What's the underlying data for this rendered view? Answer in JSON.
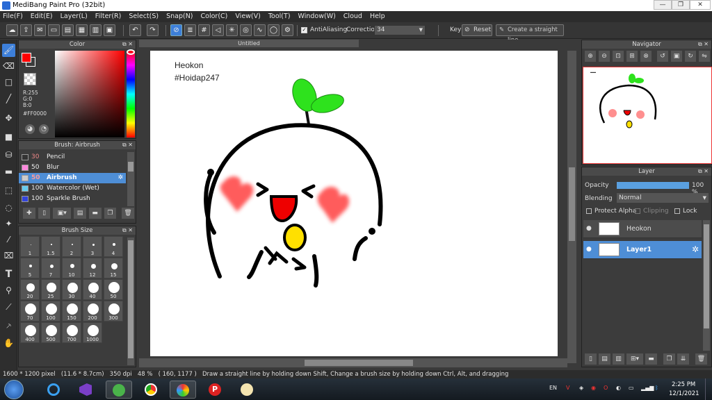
{
  "window": {
    "title": "MediBang Paint Pro (32bit)"
  },
  "menu": [
    "File(F)",
    "Edit(E)",
    "Layer(L)",
    "Filter(R)",
    "Select(S)",
    "Snap(N)",
    "Color(C)",
    "View(V)",
    "Tool(T)",
    "Window(W)",
    "Cloud",
    "Help"
  ],
  "toolbar": {
    "antialias_label": "AntiAliasing",
    "correction_label": "Correction",
    "correction_value": "34",
    "key_label": "Key",
    "reset_label": "Reset",
    "straight_line_label": "Create a straight line"
  },
  "color_panel": {
    "title": "Color",
    "r": "R:255",
    "g": "G:0",
    "b": "B:0",
    "hex": "#FF0000",
    "primary_color": "#ff0000",
    "secondary_color": "#000000"
  },
  "brush_panel": {
    "title": "Brush: Airbrush",
    "items": [
      {
        "size": "30",
        "name": "Pencil",
        "color": "#333333"
      },
      {
        "size": "50",
        "name": "Blur",
        "color": "#ff88dd"
      },
      {
        "size": "50",
        "name": "Airbrush",
        "color": "#cccccc"
      },
      {
        "size": "100",
        "name": "Watercolor (Wet)",
        "color": "#66ccee"
      },
      {
        "size": "100",
        "name": "Sparkle Brush",
        "color": "#3344dd"
      }
    ]
  },
  "brush_size_panel": {
    "title": "Brush Size",
    "sizes": [
      "1",
      "1.5",
      "2",
      "3",
      "4",
      "5",
      "7",
      "10",
      "12",
      "15",
      "20",
      "25",
      "30",
      "40",
      "50",
      "70",
      "100",
      "150",
      "200",
      "300",
      "400",
      "500",
      "700",
      "1000"
    ]
  },
  "canvas": {
    "tab_title": "Untitled",
    "text_line1": "Heokon",
    "text_line2": "#Hoidap247"
  },
  "navigator": {
    "title": "Navigator"
  },
  "layer_panel": {
    "title": "Layer",
    "opacity_label": "Opacity",
    "opacity_value": "100 %",
    "opacity_fraction": 1.0,
    "blending_label": "Blending",
    "blending_value": "Normal",
    "protect_alpha": "Protect Alpha",
    "clipping": "Clipping",
    "lock": "Lock",
    "layers": [
      {
        "name": "Heokon"
      },
      {
        "name": "Layer1"
      }
    ]
  },
  "status": {
    "size": "1600 * 1200 pixel",
    "cm": "(11.6 * 8.7cm)",
    "dpi": "350 dpi",
    "zoom": "48 %",
    "coords": "( 160, 1177 )",
    "hint": "Draw a straight line by holding down Shift, Change a brush size by holding down Ctrl, Alt, and dragging"
  },
  "taskbar": {
    "lang": "EN",
    "time": "2:25 PM",
    "date": "12/1/2021"
  }
}
